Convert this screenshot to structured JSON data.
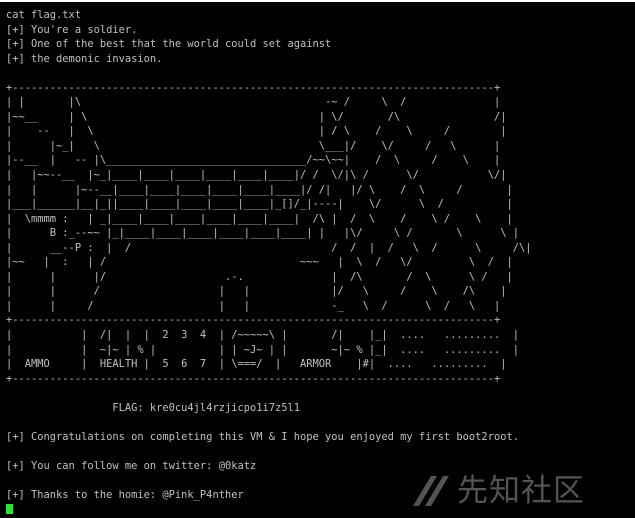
{
  "terminal": {
    "lines": [
      "cat flag.txt",
      "[+] You're a soldier.",
      "[+] One of the best that the world could set against",
      "[+] the demonic invasion.",
      "",
      "+-----------------------------------------------------------------------------+",
      "| |       |\\                                       -~ /     \\  /              |",
      "|~~__     | \\                                     | \\/       /\\               /|",
      "|    --   |  \\                                    | / \\    /    \\     /        |",
      "|      |~_|   \\                                   \\___|/    \\/     /   \\      |",
      "|--__  |   -- |\\________________________________/~~\\~~|    /  \\     /    \\    |",
      "|   |~~--__  |~_|____|____|____|____|____|____|/ /  \\/|\\ /      \\/           \\/|",
      "|   |      |~--__|____|____|____|____|____|____|/ /|   |/ \\    /  \\     /       |",
      "|___|______|__|_||____|____|____|____|____|_[]/_|----|    \\/      \\  /          |",
      "|  \\mmmm :   | _|____|____|____|____|____|____|  /\\ |  /  \\    /    \\ /    \\    |",
      "|      B :_--~~ |_|____|____|____|____|____|____| |   |\\/     \\ /       \\      \\ |",
      "|      __--P :  |  /                                /  /  |  /   \\  /      \\     /\\|",
      "|~~   |  :   | /                               ~~~   |  \\  /   \\/         \\  /  |",
      "|      |      |/                   .-.              |  /\\       /  \\      \\ /   |",
      "|      |      /                   |   |             |/   \\     /    \\    /\\    |",
      "|      |     /                    |   |             -_   \\  /      \\  /   \\   |",
      "+-----------------------------------------------------------------------------+",
      "|           |  /|  |  |  2  3  4  | /~~~~~\\ |       /|    |_|  ....   .........  |",
      "|           |  ~|~ | % |          | | ~J~ | |       ~|~ % |_|  ....   .........  |",
      "|  AMMO     |  HEALTH |  5  6  7  | \\===/  |   ARMOR    |#|  ....   .........  |",
      "+-----------------------------------------------------------------------------+",
      "",
      "                 FLAG: kre0cu4jl4rzjicpo1i7z5l1",
      "",
      "[+] Congratulations on completing this VM & I hope you enjoyed my first boot2root.",
      "",
      "[+] You can follow me on twitter: @0katz",
      "",
      "[+] Thanks to the homie: @Pink_P4nther"
    ]
  },
  "colors": {
    "background": "#000000",
    "text": "#c0c0c0",
    "cursor": "#2fe03a"
  },
  "watermark": {
    "icon": "xianzhi-logo-icon",
    "text": "先知社区"
  }
}
